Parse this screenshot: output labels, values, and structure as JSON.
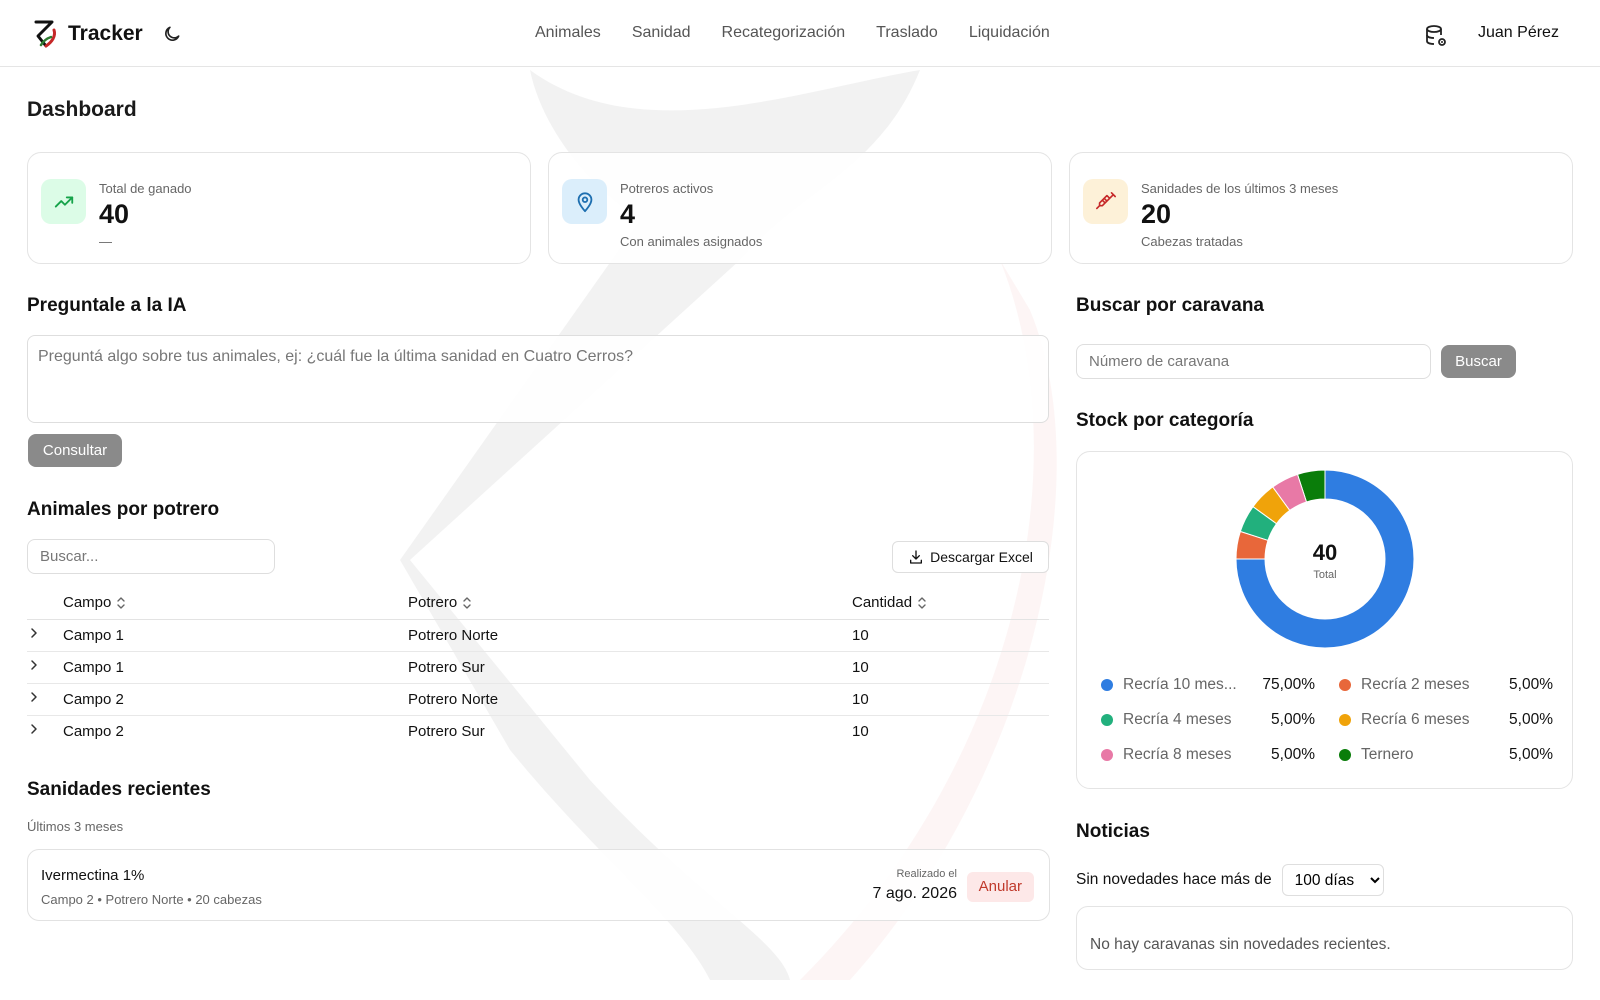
{
  "app": {
    "name": "Tracker"
  },
  "nav": {
    "items": [
      "Animales",
      "Sanidad",
      "Recategorización",
      "Traslado",
      "Liquidación"
    ]
  },
  "user": {
    "name": "Juan Pérez"
  },
  "page": {
    "title": "Dashboard"
  },
  "stats": [
    {
      "label": "Total de ganado",
      "value": "40",
      "sub": "—",
      "icon": "trending-up-icon",
      "color": "#16a34a",
      "bg": "#dcfce7"
    },
    {
      "label": "Potreros activos",
      "value": "4",
      "sub": "Con animales asignados",
      "icon": "map-pin-icon",
      "color": "#1e6fb0",
      "bg": "#dbeefb"
    },
    {
      "label": "Sanidades de los últimos 3 meses",
      "value": "20",
      "sub": "Cabezas tratadas",
      "icon": "syringe-icon",
      "color": "#c62828",
      "bg": "#fdf1d8"
    }
  ],
  "ia": {
    "title": "Preguntale a la IA",
    "placeholder": "Preguntá algo sobre tus animales, ej: ¿cuál fue la última sanidad en Cuatro Cerros?",
    "button": "Consultar"
  },
  "search": {
    "title": "Buscar por caravana",
    "placeholder": "Número de caravana",
    "button": "Buscar"
  },
  "potreros": {
    "title": "Animales por potrero",
    "search_placeholder": "Buscar...",
    "download": "Descargar Excel",
    "columns": [
      "Campo",
      "Potrero",
      "Cantidad"
    ],
    "rows": [
      [
        "Campo 1",
        "Potrero Norte",
        "10"
      ],
      [
        "Campo 1",
        "Potrero Sur",
        "10"
      ],
      [
        "Campo 2",
        "Potrero Norte",
        "10"
      ],
      [
        "Campo 2",
        "Potrero Sur",
        "10"
      ]
    ]
  },
  "stock": {
    "title": "Stock por categoría",
    "total": "40",
    "total_label": "Total"
  },
  "chart_data": {
    "type": "pie",
    "categories": [
      "Recría 10 mes...",
      "Recría 2 meses",
      "Recría 4 meses",
      "Recría 6 meses",
      "Recría 8 meses",
      "Ternero"
    ],
    "values": [
      75,
      5,
      5,
      5,
      5,
      5
    ],
    "labels": [
      "75,00%",
      "5,00%",
      "5,00%",
      "5,00%",
      "5,00%",
      "5,00%"
    ],
    "colors": [
      "#2f7de1",
      "#e8673a",
      "#22b07d",
      "#f0a30a",
      "#e879a6",
      "#0a7d0a"
    ],
    "legend": "bottom"
  },
  "sanidades": {
    "title": "Sanidades recientes",
    "subtitle": "Últimos 3 meses",
    "items": [
      {
        "name": "Ivermectina 1%",
        "meta": "Campo 2 • Potrero Norte • 20 cabezas",
        "when_label": "Realizado el",
        "date": "7 ago. 2026",
        "action": "Anular"
      }
    ]
  },
  "news": {
    "title": "Noticias",
    "label": "Sin novedades hace más de",
    "selected": "100 días",
    "empty": "No hay caravanas sin novedades recientes."
  }
}
